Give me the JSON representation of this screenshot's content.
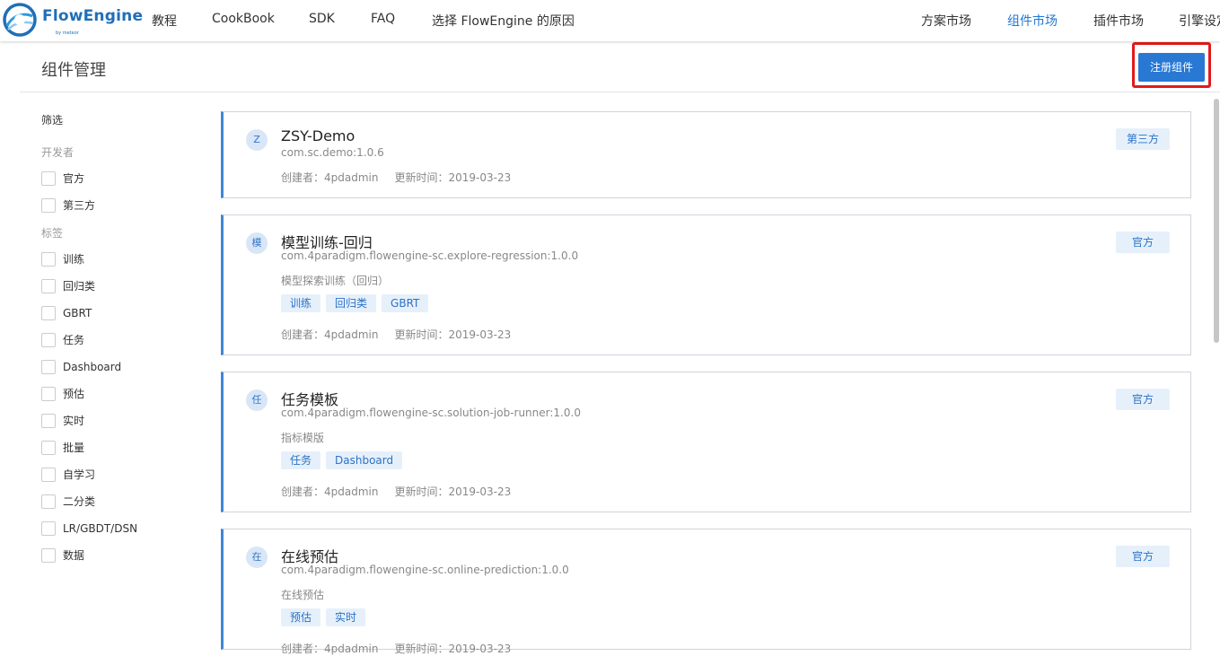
{
  "nav": {
    "brand": "FlowEngine",
    "brand_sub": "by meteor",
    "links": [
      "教程",
      "CookBook",
      "SDK",
      "FAQ",
      "选择 FlowEngine 的原因"
    ],
    "right_links": [
      "方案市场",
      "组件市场",
      "插件市场",
      "引擎设定"
    ],
    "active": "组件市场"
  },
  "page": {
    "title": "组件管理",
    "register_button": "注册组件"
  },
  "sidebar": {
    "title": "筛选",
    "developer_label": "开发者",
    "developer_options": [
      "官方",
      "第三方"
    ],
    "tag_label": "标签",
    "tag_options": [
      "训练",
      "回归类",
      "GBRT",
      "任务",
      "Dashboard",
      "预估",
      "实时",
      "批量",
      "自学习",
      "二分类",
      "LR/GBDT/DSN",
      "数据"
    ]
  },
  "cards": [
    {
      "avatar": "Z",
      "title": "ZSY-Demo",
      "id": "com.sc.demo:1.0.6",
      "desc": "",
      "tags": [],
      "creator": "创建者：4pdadmin",
      "updated": "更新时间：2019-03-23",
      "badge": "第三方"
    },
    {
      "avatar": "模",
      "title": "模型训练-回归",
      "id": "com.4paradigm.flowengine-sc.explore-regression:1.0.0",
      "desc": "模型探索训练（回归）",
      "tags": [
        "训练",
        "回归类",
        "GBRT"
      ],
      "creator": "创建者：4pdadmin",
      "updated": "更新时间：2019-03-23",
      "badge": "官方"
    },
    {
      "avatar": "任",
      "title": "任务模板",
      "id": "com.4paradigm.flowengine-sc.solution-job-runner:1.0.0",
      "desc": "指标模版",
      "tags": [
        "任务",
        "Dashboard"
      ],
      "creator": "创建者：4pdadmin",
      "updated": "更新时间：2019-03-23",
      "badge": "官方"
    },
    {
      "avatar": "在",
      "title": "在线预估",
      "id": "com.4paradigm.flowengine-sc.online-prediction:1.0.0",
      "desc": "在线预估",
      "tags": [
        "预估",
        "实时"
      ],
      "creator": "创建者：4pdadmin",
      "updated": "更新时间：2019-03-23",
      "badge": "官方"
    }
  ],
  "colors": {
    "accent": "#2878d4",
    "nav_active": "#1f77d4",
    "tag_bg": "#e6f0fb",
    "highlight": "#e3191b"
  }
}
